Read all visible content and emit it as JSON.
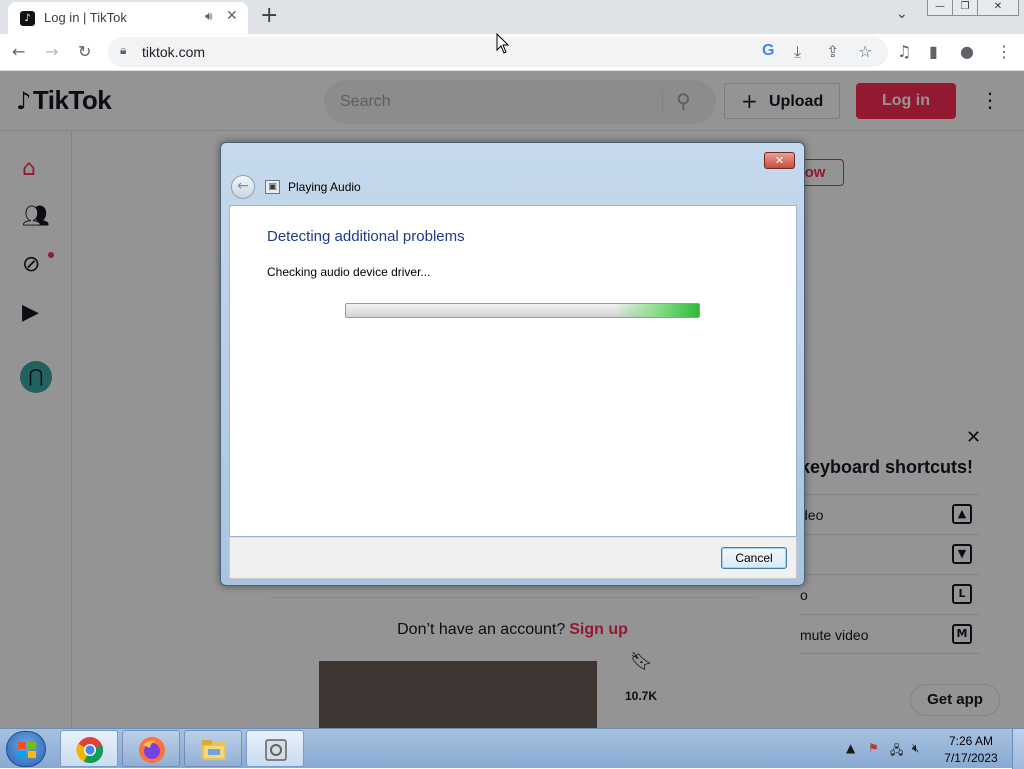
{
  "browser": {
    "tab_title": "Log in | TikTok",
    "tab_favicon": "tiktok-note-icon",
    "url": "tiktok.com",
    "new_tab_label": "+",
    "icons": [
      "back-arrow-icon",
      "forward-arrow-icon",
      "reload-icon",
      "lock-icon",
      "google-icon",
      "download-icon",
      "share-icon",
      "star-icon",
      "media-control-icon",
      "side-panel-icon",
      "profile-icon",
      "kebab-menu-icon"
    ]
  },
  "tiktok": {
    "logo_text": "TikTok",
    "search_placeholder": "Search",
    "upload_label": "Upload",
    "login_label": "Log in",
    "follow_label": "ow",
    "signup_prompt": "Don’t have an account?",
    "signup_link": "Sign up",
    "kb_title": "keyboard shortcuts!",
    "kb_rows": [
      {
        "text": "deo",
        "key": "▲"
      },
      {
        "text": "",
        "key": "▼"
      },
      {
        "text": "o",
        "key": "L"
      },
      {
        "text": "mute video",
        "key": "M"
      }
    ],
    "likes_count": "10.7K",
    "get_app_label": "Get app",
    "brand_color": "#fe2c55"
  },
  "dialog": {
    "window_title": "Playing Audio",
    "heading": "Detecting additional problems",
    "status": "Checking audio device driver...",
    "progress_indeterminate": true,
    "cancel_label": "Cancel",
    "close_glyph": "✕"
  },
  "taskbar": {
    "apps": [
      "chrome-icon",
      "firefox-icon",
      "file-explorer-icon",
      "troubleshooter-icon"
    ],
    "clock_time": "7:26 AM",
    "clock_date": "7/17/2023"
  }
}
